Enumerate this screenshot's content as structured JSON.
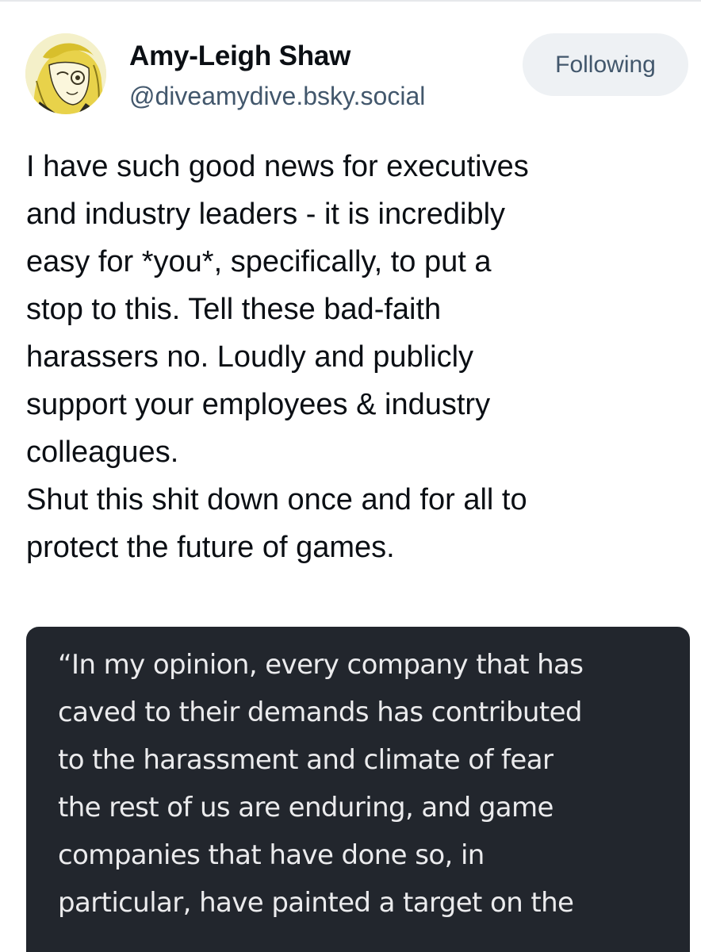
{
  "author": {
    "display_name": "Amy-Leigh Shaw",
    "handle": "@diveamydive.bsky.social",
    "avatar_icon": "user-avatar-illustration"
  },
  "follow_button": {
    "label": "Following"
  },
  "post": {
    "lines": [
      "I have such good news for executives",
      "and industry leaders - it is incredibly",
      "easy for *you*, specifically, to put a",
      "stop to this. Tell these bad-faith",
      "harassers no. Loudly and publicly",
      "support your employees & industry",
      "colleagues.",
      "Shut this shit down once and for all to",
      "protect the future of games."
    ]
  },
  "quote": {
    "lines": [
      "“In my opinion, every company that has",
      "caved to their demands has contributed",
      "to the harassment and climate of fear",
      "the rest of us are enduring, and game",
      "companies that have done so, in",
      "particular, have painted a target on the"
    ]
  },
  "colors": {
    "text_primary": "#0b0f14",
    "text_secondary": "#42576c",
    "button_bg": "#eef1f4",
    "quote_bg": "#22262d",
    "quote_text": "#ebebed"
  }
}
